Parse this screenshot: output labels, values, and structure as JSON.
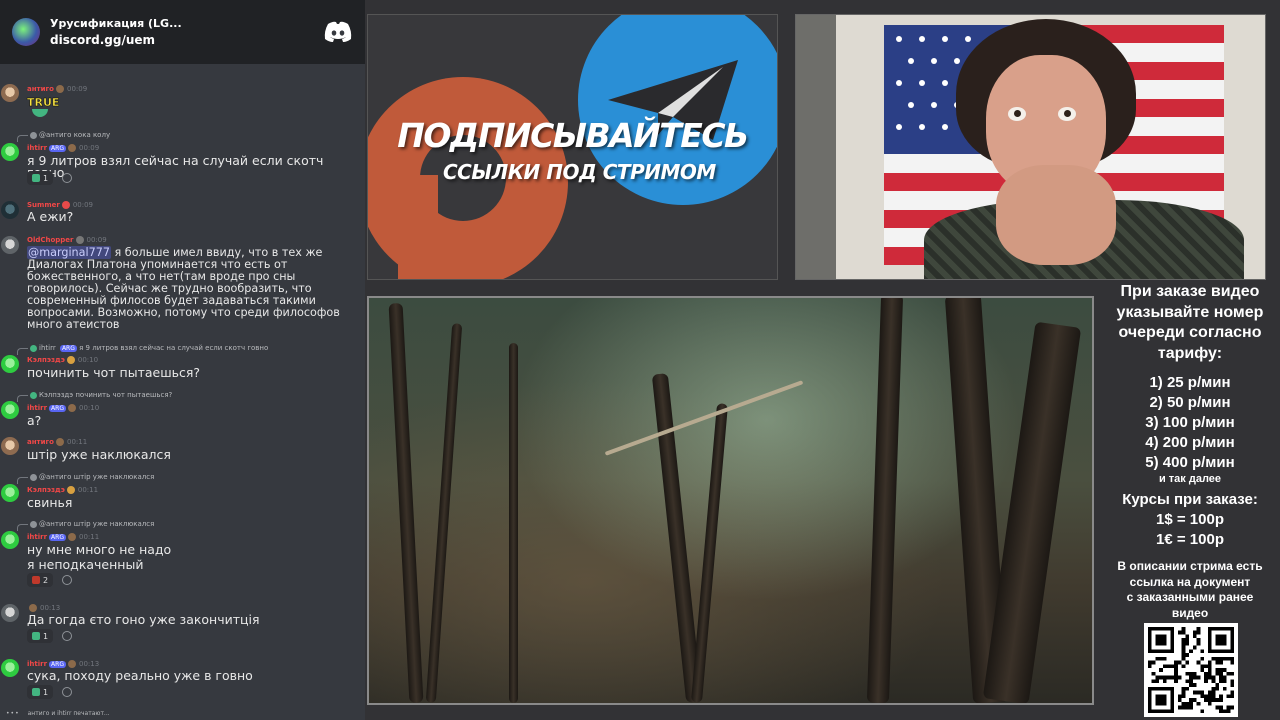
{
  "chat": {
    "server_name": "Урусификация (LG...",
    "invite": "discord.gg/uem",
    "messages": [
      {
        "author": "антиго",
        "time": "00:09",
        "sticker": "TRUE"
      },
      {
        "reply_author": "@антиго",
        "reply": "кока колу",
        "author": "ihtirr",
        "tag": "ARG",
        "time": "00:09",
        "text": "я 9 литров взял сейчас на случай если скотч говно",
        "reaction_count": "1"
      },
      {
        "author": "Summer",
        "time": "00:09",
        "text": "А ежи?"
      },
      {
        "author": "OldChopper",
        "time": "00:09",
        "mention": "@marginal777",
        "text": " я больше имел ввиду, что в тех же Диалогах Платона упоминается что есть от божественного, а что нет(там вроде про сны говорилось). Сейчас же трудно вообразить, что современный филосов будет задаваться такими вопросами. Возможно, потому что среди философов много атеистов"
      },
      {
        "reply_author": "ihtirr",
        "reply_tag": "ARG",
        "reply": "я 9 литров взял сейчас на случай если скотч говно",
        "author": "Кэлпэздэ",
        "time": "00:10",
        "text": "починить чот пытаешься?"
      },
      {
        "reply_author": "Кэлпэздэ",
        "reply": "починить чот пытаешься?",
        "author": "ihtirr",
        "tag": "ARG",
        "time": "00:10",
        "text": "а?"
      },
      {
        "author": "антиго",
        "time": "00:11",
        "text": "штір уже наклюкался"
      },
      {
        "reply_author": "@антиго",
        "reply": "штір уже наклюкался",
        "author": "Кэлпэздэ",
        "time": "00:11",
        "text": "свинья"
      },
      {
        "reply_author": "@антиго",
        "reply": "штір уже наклюкался",
        "author": "ihtirr",
        "tag": "ARG",
        "time": "00:11",
        "text_lines": [
          "ну мне много не надо",
          "я неподкаченный"
        ],
        "reaction_count": "2"
      },
      {
        "author": "",
        "time": "00:13",
        "text": "Да гогда єто гоно уже закончитція",
        "reaction_count": "1"
      },
      {
        "author": "ihtirr",
        "tag": "ARG",
        "time": "00:13",
        "text": "сука, походу реально уже в говно",
        "reaction_count": "1"
      }
    ],
    "typing": "антиго и ihtirr печатают..."
  },
  "banner": {
    "title": "ПОДПИСЫВАЙТЕСЬ",
    "subtitle": "ССЫЛКИ ПОД СТРИМОМ"
  },
  "info": {
    "heading": [
      "При заказе видео",
      "указывайте номер",
      "очереди согласно",
      "тарифу:"
    ],
    "tariffs": [
      "1) 25 р/мин",
      "2) 50 р/мин",
      "3) 100 р/мин",
      "4) 200 р/мин",
      "5) 400 р/мин"
    ],
    "tariffs_more": "и так далее",
    "rates_title": "Курсы при заказе:",
    "rates": [
      "1$ = 100р",
      "1€ = 100р"
    ],
    "description": [
      "В описании стрима есть",
      "ссылка на документ",
      "с заказанными ранее",
      "видео"
    ]
  },
  "colors": {
    "discord_bg": "#36393f",
    "discord_header": "#202225",
    "author_red": "#f04747",
    "patreon": "#c05a3a",
    "telegram": "#2a8fd6"
  }
}
